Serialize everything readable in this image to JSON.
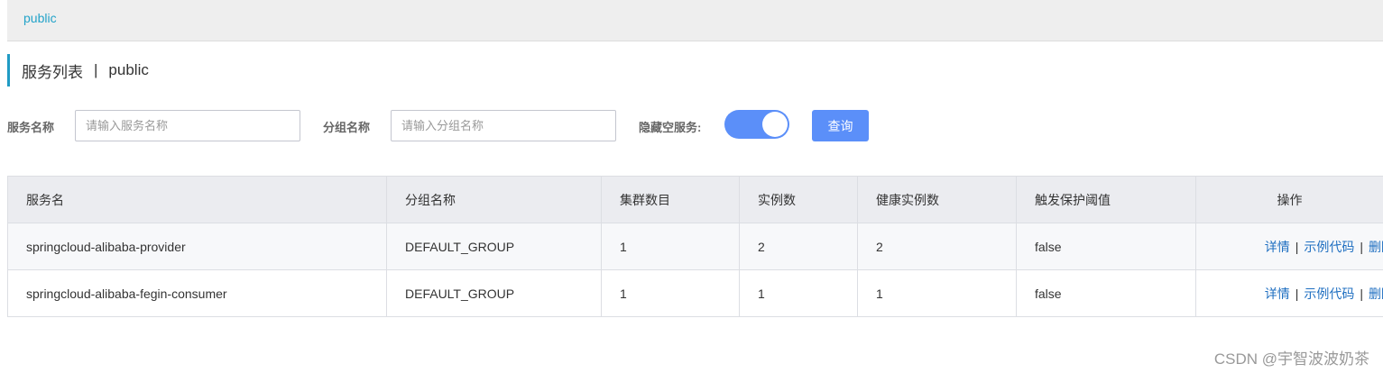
{
  "namespace_bar": {
    "items": [
      "public"
    ]
  },
  "page_title": {
    "main": "服务列表",
    "separator": "|",
    "namespace": "public"
  },
  "filters": {
    "service_name": {
      "label": "服务名称",
      "placeholder": "请输入服务名称",
      "value": ""
    },
    "group_name": {
      "label": "分组名称",
      "placeholder": "请输入分组名称",
      "value": ""
    },
    "hide_empty": {
      "label": "隐藏空服务:",
      "on": true
    },
    "query_button": "查询"
  },
  "table": {
    "columns": [
      "服务名",
      "分组名称",
      "集群数目",
      "实例数",
      "健康实例数",
      "触发保护阈值",
      "操作"
    ],
    "rows": [
      {
        "service": "springcloud-alibaba-provider",
        "group": "DEFAULT_GROUP",
        "clusters": "1",
        "instances": "2",
        "healthy": "2",
        "threshold": "false"
      },
      {
        "service": "springcloud-alibaba-fegin-consumer",
        "group": "DEFAULT_GROUP",
        "clusters": "1",
        "instances": "1",
        "healthy": "1",
        "threshold": "false"
      }
    ],
    "operations": {
      "detail": "详情",
      "sample_code": "示例代码",
      "delete": "删除",
      "separator": "|"
    }
  },
  "watermark": "CSDN @宇智波波奶茶",
  "colors": {
    "accent": "#5b8ff9",
    "link": "#1f6fc1",
    "namespace": "#23a3c9",
    "title_bar": "#209bc4"
  }
}
